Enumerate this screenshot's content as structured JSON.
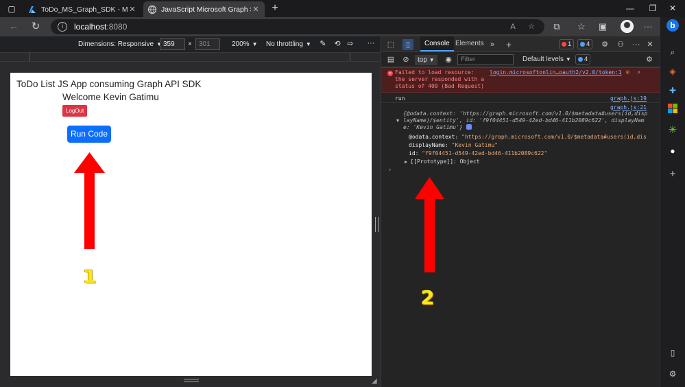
{
  "browser": {
    "tabs": [
      {
        "title": "ToDo_MS_Graph_SDK - Microsoft",
        "active": false
      },
      {
        "title": "JavaScript Microsoft Graph SPA",
        "active": true
      }
    ],
    "url_host": "localhost",
    "url_port": ":8080",
    "icons": {
      "back": "back-arrow-icon",
      "refresh": "refresh-icon",
      "info": "info-icon",
      "read_aloud": "read-aloud-icon",
      "favorite_add": "star-add-icon",
      "extensions": "extensions-icon",
      "favorites": "favorites-icon",
      "collections": "collections-icon",
      "more": "ellipsis-icon",
      "bing": "bing-icon"
    }
  },
  "device_toolbar": {
    "dimensions_label": "Dimensions: Responsive",
    "width": "359",
    "height": "301",
    "x": "×",
    "zoom": "200%",
    "throttling": "No throttling"
  },
  "app": {
    "title": "ToDo List JS App consuming Graph API SDK",
    "welcome": "Welcome Kevin Gatimu",
    "logout_label": "LogOut",
    "run_label": "Run Code"
  },
  "devtools": {
    "tabs": [
      "Console",
      "Elements"
    ],
    "error_count": "1",
    "info_count": "4",
    "context": "top",
    "filter_placeholder": "Filter",
    "levels": "Default levels",
    "levels_badge": "4",
    "messages": {
      "error_text_1": "Failed to load resource:",
      "error_text_2": "the server responded with a",
      "error_text_3": "status of 400 (Bad Request)",
      "error_source": "login.microsoftonlin…oauth2/v2.0/token:1",
      "run_text": "run",
      "run_source": "graph.js:19",
      "obj_source": "graph.js:21",
      "obj_line_1": "{@odata.context: 'https://graph.microsoft.com/v1.0/$metadata#users(id,disp",
      "obj_line_2": "layName)/$entity', id: 'f9f04451-d549-42ed-bd46-411b2089c622', displayNam",
      "obj_line_3": "e: 'Kevin Gatimu'}",
      "prop_context_key": "@odata.context",
      "prop_context_val": "\"https://graph.microsoft.com/v1.0/$metadata#users(id,dis",
      "prop_display_key": "displayName",
      "prop_display_val": "\"Kevin Gatimu\"",
      "prop_id_key": "id",
      "prop_id_val": "\"f9f04451-d549-42ed-bd46-411b2089c622\"",
      "prototype": "[[Prototype]]: Object"
    }
  },
  "annotations": {
    "label_1": "1",
    "label_2": "2",
    "arrow_color": "#ff0000",
    "label_color": "#f8e71c"
  }
}
